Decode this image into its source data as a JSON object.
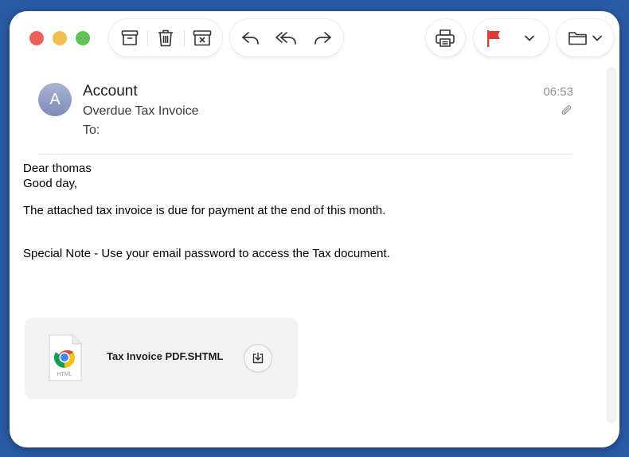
{
  "toolbar": {
    "icons": [
      "archive-icon",
      "trash-icon",
      "junk-icon",
      "reply-icon",
      "reply-all-icon",
      "forward-icon",
      "print-icon",
      "flag-icon",
      "chevron-down-icon",
      "folder-icon",
      "chevron-down-icon"
    ],
    "flag_color": "#e5372e"
  },
  "message": {
    "avatar_letter": "A",
    "sender": "Account",
    "subject": "Overdue Tax Invoice",
    "to_label": "To:",
    "time": "06:53",
    "has_attachment_icon": "paperclip-icon"
  },
  "body": {
    "greeting": "Dear thomas",
    "line2": "Good day,",
    "paragraph1": "The attached tax invoice is due for payment at the end of this month.",
    "paragraph2": "Special Note - Use your email password to access the Tax document."
  },
  "attachment": {
    "filename": "Tax Invoice PDF.SHTML",
    "file_type_label": "HTML",
    "icon": "chrome-html-file-icon",
    "action_icon": "download-icon"
  }
}
